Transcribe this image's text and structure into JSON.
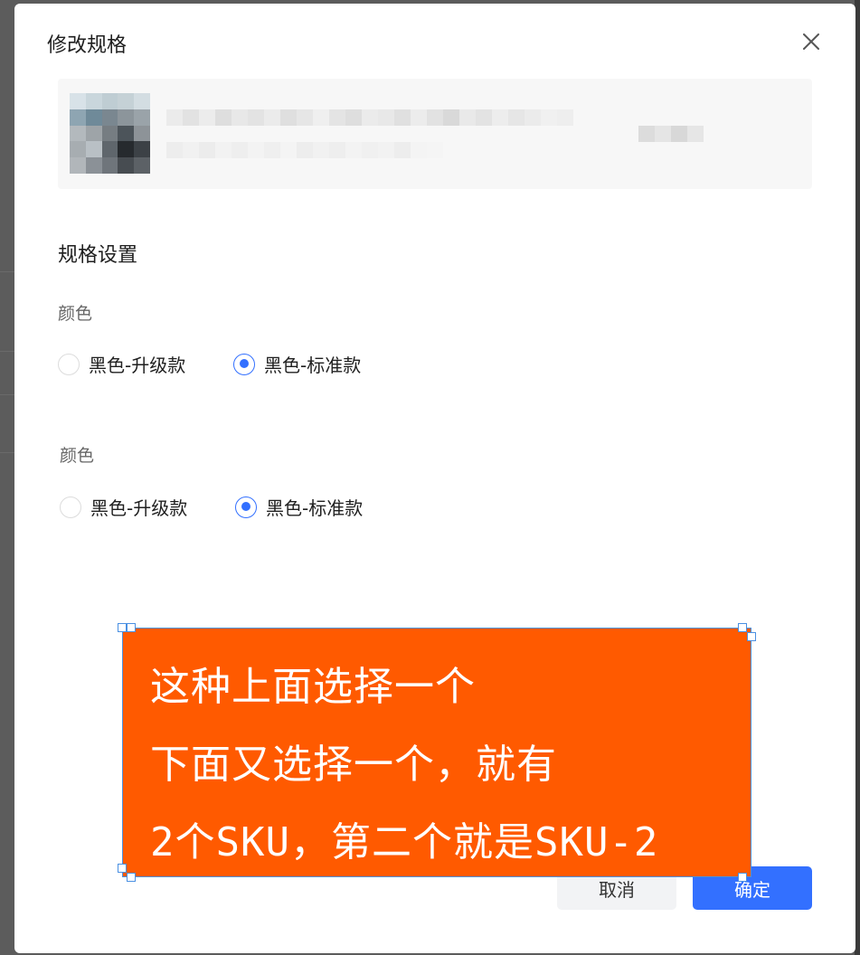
{
  "dialog": {
    "title": "修改规格",
    "close_icon": "close-icon"
  },
  "spec": {
    "section_title": "规格设置",
    "groups": [
      {
        "label": "颜色",
        "options": [
          {
            "label": "黑色-升级款",
            "checked": false
          },
          {
            "label": "黑色-标准款",
            "checked": true
          }
        ]
      },
      {
        "label": "颜色",
        "options": [
          {
            "label": "黑色-升级款",
            "checked": false
          },
          {
            "label": "黑色-标准款",
            "checked": true
          }
        ]
      }
    ]
  },
  "footer": {
    "cancel_label": "取消",
    "ok_label": "确定"
  },
  "annotation": {
    "lines": [
      "这种上面选择一个",
      "下面又选择一个，就有",
      "2个SKU，第二个就是SKU-2"
    ]
  },
  "colors": {
    "primary": "#3370ff",
    "annotation_bg": "#ff5a00"
  }
}
